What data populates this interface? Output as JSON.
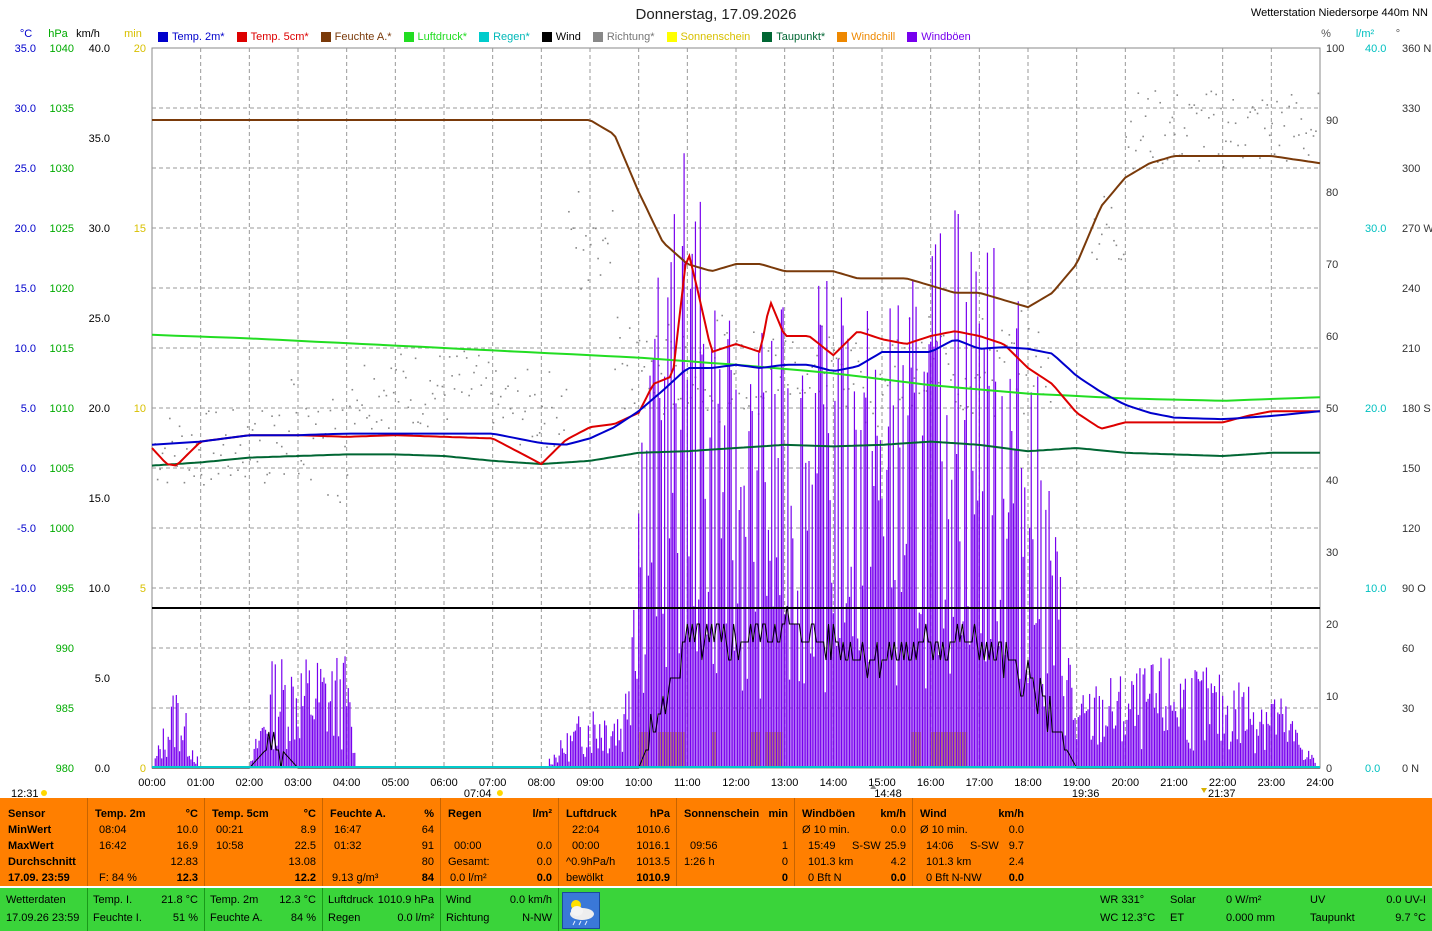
{
  "title": "Donnerstag, 17.09.2026",
  "station": "Wetterstation Niedersorpe 440m NN",
  "axes": {
    "left_units": [
      "°C",
      "hPa",
      "km/h",
      "min"
    ],
    "right_units": [
      "%",
      "l/m²",
      "°"
    ],
    "temp_ticks": [
      "35.0",
      "30.0",
      "25.0",
      "20.0",
      "15.0",
      "10.0",
      "5.0",
      "0.0",
      "-5.0",
      "-10.0"
    ],
    "hpa_ticks": [
      "1040",
      "1035",
      "1030",
      "1025",
      "1020",
      "1015",
      "1010",
      "1005",
      "1000",
      "995",
      "990",
      "985",
      "980"
    ],
    "kmh_ticks": [
      "40.0",
      "35.0",
      "30.0",
      "25.0",
      "20.0",
      "15.0",
      "10.0",
      "5.0",
      "0.0"
    ],
    "min_ticks": [
      "20",
      "15",
      "10",
      "5",
      "0"
    ],
    "pct_ticks": [
      "100",
      "90",
      "80",
      "70",
      "60",
      "50",
      "40",
      "30",
      "20",
      "10",
      "0"
    ],
    "lm2_ticks": [
      "40.0",
      "30.0",
      "20.0",
      "10.0",
      "0.0"
    ],
    "deg_ticks": [
      "360 N",
      "330",
      "300",
      "270 W",
      "240",
      "210",
      "180 S",
      "150",
      "120",
      "90 O",
      "60",
      "30",
      "0 N"
    ],
    "x_ticks": [
      "00:00",
      "01:00",
      "02:00",
      "03:00",
      "04:00",
      "05:00",
      "06:00",
      "07:00",
      "08:00",
      "09:00",
      "10:00",
      "11:00",
      "12:00",
      "13:00",
      "14:00",
      "15:00",
      "16:00",
      "17:00",
      "18:00",
      "19:00",
      "20:00",
      "21:00",
      "22:00",
      "23:00",
      "24:00"
    ]
  },
  "markers": {
    "moonrise": "12:31",
    "sunrise": "07:04",
    "noon": "14:48",
    "sunset": "19:36",
    "moonset": "21:37"
  },
  "legend": [
    {
      "label": "Temp. 2m*",
      "color": "#0000cc"
    },
    {
      "label": "Temp. 5cm*",
      "color": "#dd0000"
    },
    {
      "label": "Feuchte A.*",
      "color": "#7a3a0a"
    },
    {
      "label": "Luftdruck*",
      "color": "#22dd22"
    },
    {
      "label": "Regen*",
      "color": "#00cccc"
    },
    {
      "label": "Wind",
      "color": "#000000"
    },
    {
      "label": "Richtung*",
      "color": "#888888"
    },
    {
      "label": "Sonnenschein",
      "color": "#ffff00"
    },
    {
      "label": "Taupunkt*",
      "color": "#006633"
    },
    {
      "label": "Windchill",
      "color": "#ee8800"
    },
    {
      "label": "Windböen",
      "color": "#7700ee"
    }
  ],
  "chart_data": {
    "type": "line",
    "x_unit": "hour",
    "series": [
      {
        "name": "Temp. 2m",
        "unit": "°C",
        "x": [
          0,
          1,
          2,
          3,
          4,
          5,
          6,
          7,
          8,
          8.5,
          9,
          9.5,
          10,
          10.5,
          11,
          11.5,
          12,
          12.5,
          13,
          13.5,
          14,
          14.5,
          15,
          15.5,
          16,
          16.5,
          17,
          17.5,
          18,
          18.5,
          19,
          19.5,
          20,
          20.5,
          21,
          22,
          23,
          24
        ],
        "y": [
          10.2,
          10.4,
          10.8,
          10.8,
          10.9,
          10.9,
          10.9,
          10.9,
          10.3,
          10.2,
          10.6,
          11.3,
          12.3,
          13.6,
          15.0,
          15.0,
          15.2,
          15.0,
          15.2,
          15.2,
          14.8,
          15.1,
          16.0,
          16.0,
          16.0,
          16.8,
          16.2,
          16.3,
          16.2,
          15.9,
          14.5,
          13.5,
          12.7,
          12.2,
          11.9,
          11.8,
          12.0,
          12.3
        ]
      },
      {
        "name": "Temp. 5cm",
        "unit": "°C",
        "x": [
          0,
          0.3,
          0.5,
          1,
          2,
          3,
          4,
          5,
          6,
          7,
          7.5,
          8,
          8.5,
          9,
          9.5,
          10,
          10.3,
          10.7,
          11,
          11.2,
          11.5,
          12,
          12.5,
          12.7,
          13,
          13.5,
          14,
          14.5,
          15,
          15.5,
          16,
          16.5,
          17,
          17.5,
          18,
          18.5,
          19,
          19.5,
          20,
          21,
          22,
          22.5,
          23,
          24
        ],
        "y": [
          10.0,
          9.0,
          8.9,
          10.4,
          10.8,
          10.8,
          10.7,
          10.8,
          10.7,
          10.6,
          9.8,
          9.0,
          10.5,
          11.3,
          11.5,
          12.2,
          14.0,
          14.5,
          22.5,
          20.0,
          16.0,
          16.5,
          16.0,
          19.2,
          17.0,
          17.0,
          15.8,
          17.3,
          16.8,
          16.5,
          17.0,
          17.3,
          17.0,
          16.5,
          15.0,
          14.0,
          12.2,
          11.2,
          11.6,
          11.6,
          11.6,
          12.0,
          12.3,
          12.3
        ]
      },
      {
        "name": "Feuchte A.",
        "unit": "%",
        "x": [
          0,
          1,
          2,
          3,
          4,
          5,
          6,
          7,
          8,
          9,
          9.5,
          10,
          10.5,
          11,
          11.5,
          12,
          12.5,
          13,
          13.5,
          14,
          14.5,
          15,
          15.5,
          16,
          16.5,
          17,
          17.5,
          18,
          18.5,
          19,
          19.5,
          20,
          20.5,
          21,
          21.5,
          22,
          23,
          24
        ],
        "y": [
          90,
          90,
          90,
          90,
          90,
          90,
          90,
          90,
          90,
          90,
          88,
          80,
          73,
          70,
          69,
          70,
          70,
          69,
          69,
          69,
          68,
          68,
          68,
          67,
          66,
          66,
          65,
          64,
          66,
          70,
          78,
          82,
          84,
          85,
          85,
          85,
          85,
          84
        ]
      },
      {
        "name": "Luftdruck",
        "unit": "hPa",
        "x": [
          0,
          2,
          4,
          6,
          8,
          10,
          12,
          14,
          16,
          18,
          20,
          22,
          24
        ],
        "y": [
          1016.1,
          1015.8,
          1015.4,
          1015.0,
          1014.6,
          1014.2,
          1013.6,
          1012.9,
          1011.9,
          1011.2,
          1010.8,
          1010.6,
          1010.9
        ]
      },
      {
        "name": "Taupunkt",
        "unit": "°C",
        "x": [
          0,
          1,
          2,
          3,
          4,
          5,
          6,
          7,
          8,
          9,
          10,
          11,
          12,
          13,
          14,
          15,
          16,
          17,
          18,
          19,
          20,
          21,
          22,
          23,
          24
        ],
        "y": [
          8.9,
          9.1,
          9.4,
          9.5,
          9.6,
          9.6,
          9.5,
          9.2,
          9.0,
          9.2,
          9.7,
          9.8,
          10.0,
          10.2,
          10.1,
          10.2,
          10.4,
          10.2,
          9.8,
          10.0,
          9.7,
          9.6,
          9.5,
          9.7,
          9.7
        ]
      },
      {
        "name": "Wind",
        "unit": "km/h",
        "x": [
          0,
          0.5,
          1,
          2,
          2.5,
          3,
          4,
          9.5,
          10,
          10.3,
          11,
          12,
          13,
          14,
          15,
          16,
          17,
          18,
          19,
          20,
          24
        ],
        "y": [
          0,
          0,
          0,
          0,
          1.5,
          0,
          0,
          0,
          0,
          2,
          7,
          7,
          8,
          7,
          6,
          7,
          7,
          5,
          0,
          0,
          0
        ]
      },
      {
        "name": "Windböen",
        "unit": "km/h",
        "x": [
          0,
          0.5,
          1,
          2,
          2.5,
          3,
          4,
          4.2,
          5,
          8,
          9,
          9.7,
          10,
          11,
          12,
          13,
          14,
          15,
          16,
          16.5,
          17,
          18,
          18.5,
          19,
          19.5,
          20,
          21,
          22,
          23,
          24
        ],
        "y": [
          0,
          4,
          0,
          0,
          5,
          5,
          5,
          0,
          0,
          0,
          3,
          3,
          18,
          27,
          18,
          20,
          21,
          20,
          22,
          26,
          24,
          20,
          12,
          3,
          4,
          4,
          5,
          4,
          4,
          0
        ]
      },
      {
        "name": "Sonnenschein",
        "unit": "min",
        "x": [
          10,
          11,
          12,
          13,
          14,
          15,
          16,
          17,
          18
        ],
        "y": [
          1,
          1,
          1,
          1,
          0,
          0,
          1,
          1,
          0
        ]
      },
      {
        "name": "Regen",
        "unit": "l/m²",
        "x": [
          0,
          24
        ],
        "y": [
          0,
          0
        ]
      }
    ]
  },
  "stats": {
    "sensor_label": "Sensor",
    "row_labels": [
      "MinWert",
      "MaxWert",
      "Durchschnitt",
      "17.09. 23:59"
    ],
    "temp2m": {
      "head": "Temp. 2m",
      "unit": "°C",
      "min_t": "08:04",
      "min": "10.0",
      "max_t": "16:42",
      "max": "16.9",
      "avg": "12.83",
      "cur_note": "F: 84 %",
      "cur": "12.3"
    },
    "temp5cm": {
      "head": "Temp. 5cm",
      "unit": "°C",
      "min_t": "00:21",
      "min": "8.9",
      "max_t": "10:58",
      "max": "22.5",
      "avg": "13.08",
      "cur": "12.2"
    },
    "feuchte": {
      "head": "Feuchte A.",
      "unit": "%",
      "min_t": "16:47",
      "min": "64",
      "max_t": "01:32",
      "max": "91",
      "avg": "80",
      "cur_note": "9.13 g/m³",
      "cur": "84"
    },
    "regen": {
      "head": "Regen",
      "unit": "l/m²",
      "r2": "",
      "r3_t": "00:00",
      "r3": "0.0",
      "r4_t": "Gesamt:",
      "r4": "0.0",
      "cur_note": "0.0 l/m²",
      "cur": "0.0"
    },
    "luftdruck": {
      "head": "Luftdruck",
      "unit": "hPa",
      "min_t": "22:04",
      "min": "1010.6",
      "max_t": "00:00",
      "max": "1016.1",
      "avg_t": "^0.9hPa/h",
      "avg": "1013.5",
      "cur_note": "bewölkt",
      "cur": "1010.9"
    },
    "sonne": {
      "head": "Sonnenschein",
      "unit": "min",
      "max_t": "09:56",
      "max": "1",
      "avg_t": "1:26 h",
      "avg": "0",
      "cur": "0"
    },
    "windboeen": {
      "head": "Windböen",
      "unit": "km/h",
      "r1_t": "Ø 10 min.",
      "r1": "0.0",
      "r2_t": "15:49",
      "r2_d": "S-SW",
      "r2": "25.9",
      "r3_t": "101.3 km",
      "r3": "4.2",
      "cur_note": "0 Bft N",
      "cur": "0.0"
    },
    "wind": {
      "head": "Wind",
      "unit": "km/h",
      "r1_t": "Ø 10 min.",
      "r1": "0.0",
      "r2_t": "14:06",
      "r2_d": "S-SW",
      "r2": "9.7",
      "r3_t": "101.3 km",
      "r3": "2.4",
      "cur_note": "0 Bft N-NW",
      "cur": "0.0"
    }
  },
  "status": {
    "left_title": "Wetterdaten",
    "left_time": "17.09.26 23:59",
    "temp_i_label": "Temp. I.",
    "temp_i": "21.8 °C",
    "feuchte_i_label": "Feuchte I.",
    "feuchte_i": "51 %",
    "temp2m_label": "Temp. 2m",
    "temp2m": "12.3 °C",
    "feuchte_a_label": "Feuchte A.",
    "feuchte_a": "84 %",
    "luftdruck_label": "Luftdruck",
    "luftdruck": "1010.9 hPa",
    "regen_label": "Regen",
    "regen": "0.0 l/m²",
    "wind_label": "Wind",
    "wind": "0.0 km/h",
    "richtung_label": "Richtung",
    "richtung": "N-NW",
    "wr": "WR 331°",
    "wc": "WC 12.3°C",
    "solar_label": "Solar",
    "solar": "0 W/m²",
    "et_label": "ET",
    "et": "0.000 mm",
    "uv_label": "UV",
    "uv": "0.0 UV-I",
    "taupunkt_label": "Taupunkt",
    "taupunkt": "9.7 °C"
  }
}
